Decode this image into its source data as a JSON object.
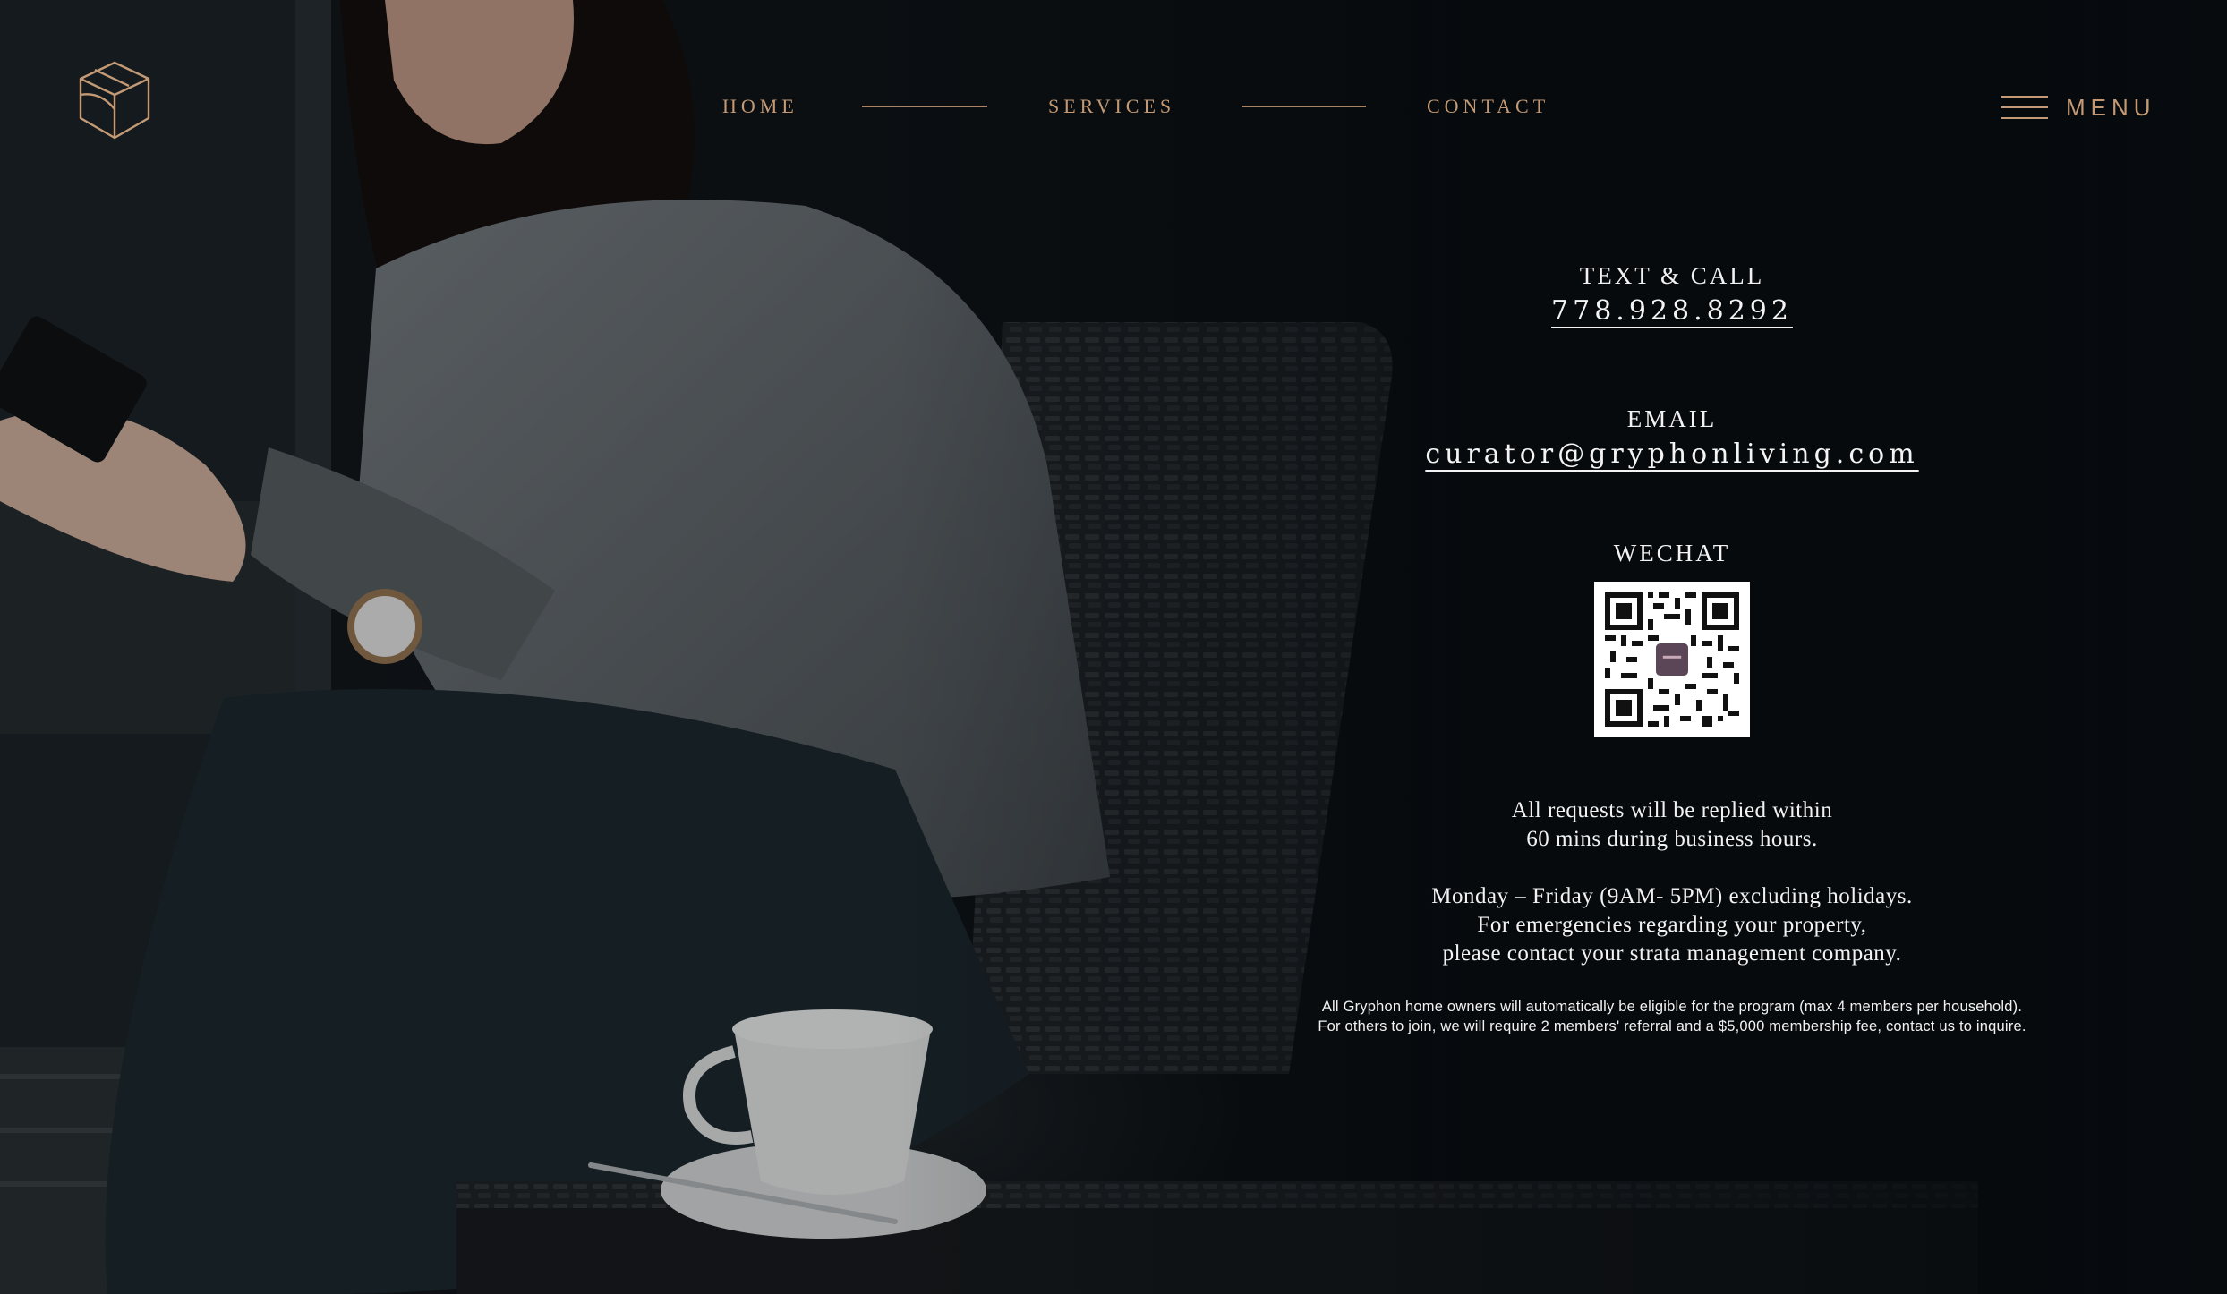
{
  "brand": {
    "logo_icon": "gryphon-cube-logo-icon",
    "accent_color": "#c49a76"
  },
  "nav": {
    "items": [
      {
        "label": "HOME"
      },
      {
        "label": "SERVICES"
      },
      {
        "label": "CONTACT"
      }
    ],
    "menu_label": "MENU",
    "menu_icon": "hamburger-icon"
  },
  "contact": {
    "call_label": "TEXT & CALL",
    "phone": "778.928.8292",
    "email_label": "EMAIL",
    "email": "curator@gryphonliving.com",
    "wechat_label": "WECHAT",
    "qr_icon": "wechat-qr-code"
  },
  "notes": {
    "reply_line1": "All requests will be replied within",
    "reply_line2": "60 mins during business hours.",
    "hours_line1": "Monday – Friday (9AM- 5PM) excluding holidays.",
    "hours_line2": "For emergencies regarding your property,",
    "hours_line3": "please contact your strata management company.",
    "fine_line1": "All Gryphon home owners will automatically be eligible for the program (max 4 members per household).",
    "fine_line2": "For others to join, we will require 2 members' referral and a $5,000 membership fee, contact us to inquire."
  }
}
